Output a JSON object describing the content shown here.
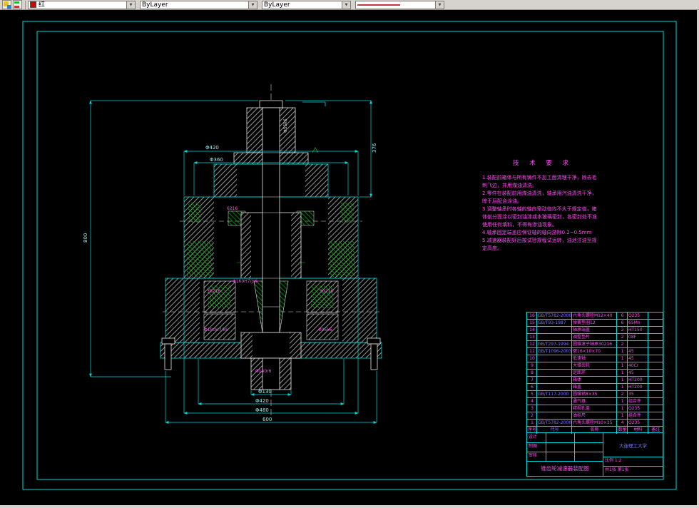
{
  "toolbar": {
    "layer_combo": {
      "value": "红"
    },
    "color_combo": {
      "value": "ByLayer"
    },
    "lineweight_combo": {
      "value": "ByLayer"
    }
  },
  "tech_requirements": {
    "title": "技 术 要 求",
    "lines": [
      "1.装配前箱体与所有铸件不加工面清理干净，除去毛",
      "刺飞边，并用煤油清洗。",
      "2.零件在装配前用煤油清洗，轴承用汽油清洗干净，",
      "晾干后配合涂油。",
      "3.调整轴承时各轴的轴向窜动值均不大于规定值，箱",
      "体剖分面涂以密封油漆或水玻璃密封，各密封处不准",
      "使用任何填料，不得有渗油现象。",
      "4.轴承固定端盖应保证轴的轴向游隙0.2~0.5mm",
      "5.减速器装配好后按试验规程试运转，油池注油至规",
      "定高度。"
    ]
  },
  "drawing": {
    "dims": {
      "overall_height": "800",
      "upper_height": "376",
      "top_outer_dia": "Φ420",
      "top_inner_dia": "Φ360",
      "shaft_end_dia": "Φ130",
      "bottom_mid_dia": "Φ420",
      "bottom_outer_dia": "Φ480",
      "base_width": "600"
    },
    "labels": {
      "bearing_upper": "6216",
      "gear_fit": "Φ160H7/js6",
      "bearing_left": "30216",
      "bearing_right": "30216",
      "fit_left": "Φ180H7/k6",
      "fit_right": "Φ95k6",
      "shaft_fit": "Φ140r6",
      "hub_fit": "Φ55k6"
    }
  },
  "bom": {
    "header": {
      "no": "序号",
      "code": "代号",
      "name": "名称",
      "qty": "数量",
      "mat": "材料",
      "note": "备注"
    },
    "rows": [
      {
        "no": "16",
        "code": "GB/T5782-2000",
        "name": "六角头螺栓M12×40",
        "qty": "6",
        "mat": "Q235",
        "note": ""
      },
      {
        "no": "15",
        "code": "GB/T93-1987",
        "name": "弹簧垫圈12",
        "qty": "6",
        "mat": "65Mn",
        "note": ""
      },
      {
        "no": "14",
        "code": "",
        "name": "轴承端盖",
        "qty": "2",
        "mat": "HT150",
        "note": ""
      },
      {
        "no": "13",
        "code": "",
        "name": "调整垫片",
        "qty": "2",
        "mat": "08F",
        "note": ""
      },
      {
        "no": "12",
        "code": "GB/T297-1994",
        "name": "圆锥滚子轴承30216",
        "qty": "2",
        "mat": "",
        "note": ""
      },
      {
        "no": "11",
        "code": "GB/T1096-2003",
        "name": "键16×10×70",
        "qty": "1",
        "mat": "45",
        "note": ""
      },
      {
        "no": "10",
        "code": "",
        "name": "低速轴",
        "qty": "1",
        "mat": "45",
        "note": ""
      },
      {
        "no": "9",
        "code": "",
        "name": "大锥齿轮",
        "qty": "1",
        "mat": "40Cr",
        "note": ""
      },
      {
        "no": "8",
        "code": "",
        "name": "定距环",
        "qty": "1",
        "mat": "45",
        "note": ""
      },
      {
        "no": "7",
        "code": "",
        "name": "箱体",
        "qty": "1",
        "mat": "HT200",
        "note": ""
      },
      {
        "no": "6",
        "code": "",
        "name": "箱盖",
        "qty": "1",
        "mat": "HT200",
        "note": ""
      },
      {
        "no": "5",
        "code": "GB/T117-2000",
        "name": "圆锥销8×35",
        "qty": "2",
        "mat": "35",
        "note": ""
      },
      {
        "no": "4",
        "code": "",
        "name": "通气器",
        "qty": "1",
        "mat": "组合件",
        "note": ""
      },
      {
        "no": "3",
        "code": "",
        "name": "窥视孔盖",
        "qty": "1",
        "mat": "Q235",
        "note": ""
      },
      {
        "no": "2",
        "code": "",
        "name": "油标尺",
        "qty": "1",
        "mat": "组合件",
        "note": ""
      },
      {
        "no": "1",
        "code": "GB/T5782-2000",
        "name": "六角头螺栓M10×35",
        "qty": "4",
        "mat": "Q235",
        "note": ""
      }
    ]
  },
  "title_block": {
    "left_rows": [
      {
        "label": "设计"
      },
      {
        "label": "制图"
      },
      {
        "label": "审核"
      }
    ],
    "drawing_title": "锥齿轮减速器装配图",
    "school": "大连理工大学",
    "scale_row": "比例 1:2",
    "sheet_row": "共1张 第1张"
  }
}
